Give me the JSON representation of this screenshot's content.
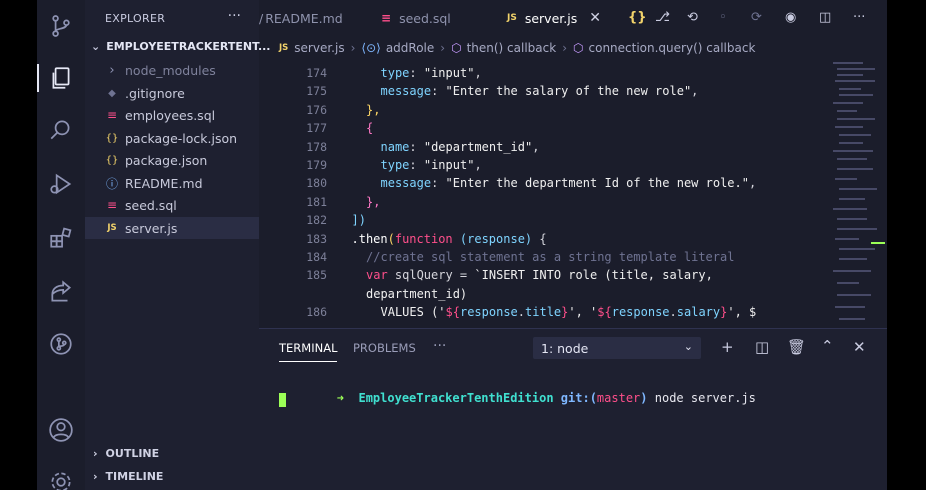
{
  "sidebar": {
    "header": "EXPLORER",
    "folder": "EMPLOYEETRACKERTENT...",
    "files": [
      {
        "name": "node_modules",
        "icon": "›",
        "icon_color": "#8e93b3",
        "dim": true
      },
      {
        "name": ".gitignore",
        "icon": "◆",
        "icon_color": "#6f7392"
      },
      {
        "name": "employees.sql",
        "icon": "≡",
        "icon_color": "#ff4f8b"
      },
      {
        "name": "package-lock.json",
        "icon": "{}",
        "icon_color": "#f2d36b"
      },
      {
        "name": "package.json",
        "icon": "{}",
        "icon_color": "#f2d36b"
      },
      {
        "name": "README.md",
        "icon": "ⓘ",
        "icon_color": "#7fb7ff"
      },
      {
        "name": "seed.sql",
        "icon": "≡",
        "icon_color": "#ff4f8b"
      },
      {
        "name": "server.js",
        "icon": "JS",
        "icon_color": "#f2d36b"
      }
    ],
    "outline": "OUTLINE",
    "timeline": "TIMELINE"
  },
  "tabs": [
    {
      "label": "README.md",
      "icon": "",
      "prefix": "/"
    },
    {
      "label": "seed.sql",
      "icon": "≡"
    },
    {
      "label": "server.js",
      "icon": "JS"
    }
  ],
  "breadcrumb": [
    "server.js",
    "addRole",
    "then() callback",
    "connection.query() callback"
  ],
  "code_lines": [
    {
      "num": "174",
      "indent": 7,
      "tokens": [
        [
          "type",
          "#7fd4ff"
        ],
        [
          ": ",
          "#d6d6dd"
        ],
        [
          "\"input\"",
          "#f0f0f0"
        ],
        [
          ",",
          "#d6d6dd"
        ]
      ]
    },
    {
      "num": "175",
      "indent": 7,
      "tokens": [
        [
          "message",
          "#7fd4ff"
        ],
        [
          ": ",
          "#d6d6dd"
        ],
        [
          "\"Enter the salary of the new role\"",
          "#f0f0f0"
        ],
        [
          ",",
          "#d6d6dd"
        ]
      ]
    },
    {
      "num": "176",
      "indent": 6,
      "tokens": [
        [
          "},",
          "#ffd866"
        ]
      ]
    },
    {
      "num": "177",
      "indent": 6,
      "tokens": [
        [
          "{",
          "#ff79c6"
        ]
      ]
    },
    {
      "num": "178",
      "indent": 7,
      "tokens": [
        [
          "name",
          "#7fd4ff"
        ],
        [
          ": ",
          "#d6d6dd"
        ],
        [
          "\"department_id\"",
          "#f0f0f0"
        ],
        [
          ",",
          "#d6d6dd"
        ]
      ]
    },
    {
      "num": "179",
      "indent": 7,
      "tokens": [
        [
          "type",
          "#7fd4ff"
        ],
        [
          ": ",
          "#d6d6dd"
        ],
        [
          "\"input\"",
          "#f0f0f0"
        ],
        [
          ",",
          "#d6d6dd"
        ]
      ]
    },
    {
      "num": "180",
      "indent": 7,
      "tokens": [
        [
          "message",
          "#7fd4ff"
        ],
        [
          ": ",
          "#d6d6dd"
        ],
        [
          "\"Enter the department Id of the new role.\"",
          "#f0f0f0"
        ],
        [
          ",",
          "#d6d6dd"
        ]
      ]
    },
    {
      "num": "181",
      "indent": 6,
      "tokens": [
        [
          "},",
          "#ff79c6"
        ]
      ]
    },
    {
      "num": "182",
      "indent": 5,
      "tokens": [
        [
          "])",
          "#7fd4ff"
        ]
      ]
    },
    {
      "num": "183",
      "indent": 5,
      "tokens": [
        [
          ".then",
          "#ffffff"
        ],
        [
          "(",
          "#ffd866"
        ],
        [
          "function",
          "#ff4f8b"
        ],
        [
          " ",
          "#d6d6dd"
        ],
        [
          "(response)",
          "#7fd4ff"
        ],
        [
          " {",
          "#d6d6dd"
        ]
      ]
    },
    {
      "num": "184",
      "indent": 6,
      "tokens": [
        [
          "//create sql statement as a string template literal",
          "#6f7392"
        ]
      ]
    },
    {
      "num": "185",
      "indent": 6,
      "tokens": [
        [
          "var",
          "#ff4f8b"
        ],
        [
          " sqlQuery = ",
          "#d6d6dd"
        ],
        [
          "`INSERT INTO role (title, salary,",
          "#f0f0f0"
        ]
      ]
    },
    {
      "num": "",
      "indent": 6,
      "tokens": [
        [
          "department_id)",
          "#f0f0f0"
        ]
      ]
    },
    {
      "num": "186",
      "indent": 7,
      "tokens": [
        [
          "VALUES ('",
          "#f0f0f0"
        ],
        [
          "${",
          "#ff4f8b"
        ],
        [
          "response",
          "#7fd4ff"
        ],
        [
          ".",
          "#d6d6dd"
        ],
        [
          "title",
          "#7fd4ff"
        ],
        [
          "}",
          "#ff4f8b"
        ],
        [
          "', '",
          "#f0f0f0"
        ],
        [
          "${",
          "#ff4f8b"
        ],
        [
          "response",
          "#7fd4ff"
        ],
        [
          ".",
          "#d6d6dd"
        ],
        [
          "salary",
          "#7fd4ff"
        ],
        [
          "}",
          "#ff4f8b"
        ],
        [
          "', $",
          "#f0f0f0"
        ]
      ]
    }
  ],
  "panel": {
    "tab_terminal": "TERMINAL",
    "tab_problems": "PROBLEMS",
    "more": "···",
    "terminal_select": "1: node",
    "prompt_arrow": "➜",
    "prompt_dir": "EmployeeTrackerTenthEdition",
    "git_label": "git:(",
    "branch": "master",
    "git_close": ")",
    "command": "node server.js"
  },
  "colors": {
    "accent_green": "#9cff57",
    "branch_red": "#ff4f8b",
    "prompt_dir": "#40e0d0"
  }
}
